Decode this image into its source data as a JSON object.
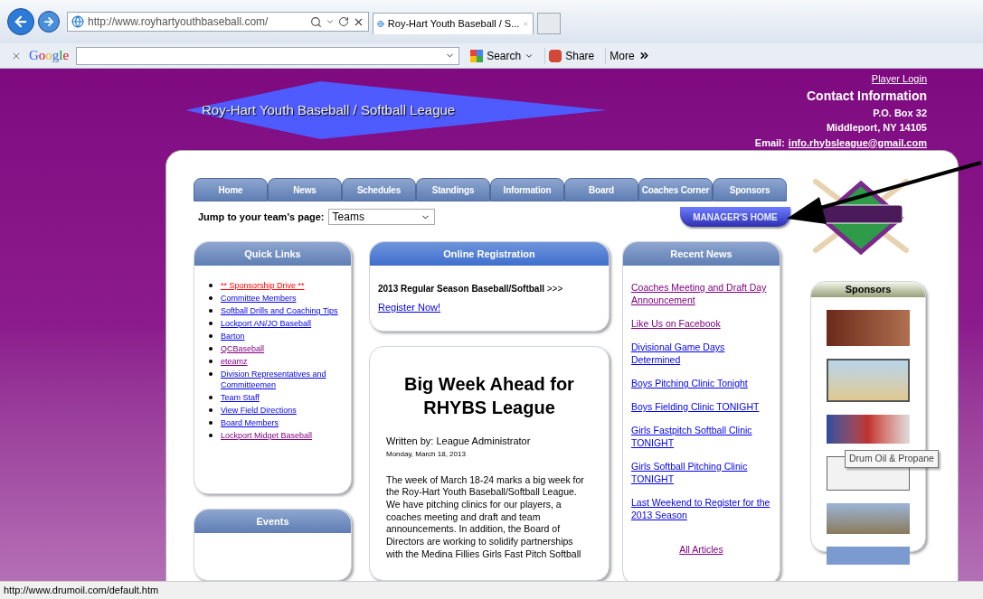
{
  "browser": {
    "url": "http://www.royhartyouthbaseball.com/",
    "tabs": [
      {
        "label": "Roy-Hart Youth Baseball / S...",
        "selected": true
      }
    ],
    "toolbar": {
      "brand": "Google",
      "search": "Search",
      "share": "Share",
      "more": "More"
    }
  },
  "header": {
    "banner_title": "Roy-Hart Youth Baseball / Softball League",
    "player_login": "Player Login",
    "contact_heading": "Contact Information",
    "contact_lines": [
      "P.O. Box 32",
      "Middleport, NY 14105"
    ],
    "email_label": "Email:",
    "email": "info.rhybsleague@gmail.com"
  },
  "nav": [
    {
      "label": "Home"
    },
    {
      "label": "News"
    },
    {
      "label": "Schedules"
    },
    {
      "label": "Standings"
    },
    {
      "label": "Information"
    },
    {
      "label": "Board"
    },
    {
      "label": "Coaches Corner"
    },
    {
      "label": "Sponsors"
    }
  ],
  "jump": {
    "label": "Jump to your team's page:",
    "value": "Teams"
  },
  "manager_button": "MANAGER'S HOME",
  "quick_links": {
    "title": "Quick Links",
    "items": [
      {
        "label": "** Sponsorship Drive **",
        "kind": "highlight"
      },
      {
        "label": "Committee Members",
        "kind": "link",
        "visited": false
      },
      {
        "label": "Softball Drills and Coaching Tips",
        "kind": "link",
        "visited": false
      },
      {
        "label": "Lockport AN/JO Baseball",
        "kind": "link",
        "visited": false
      },
      {
        "label": "Barton",
        "kind": "link",
        "visited": false
      },
      {
        "label": "QCBaseball",
        "kind": "link",
        "visited": true
      },
      {
        "label": "eteamz",
        "kind": "link",
        "visited": true
      },
      {
        "label": "Division Representatives and Committeemen",
        "kind": "link",
        "visited": false
      },
      {
        "label": "Team Staff",
        "kind": "link",
        "visited": false
      },
      {
        "label": "View Field Directions",
        "kind": "link",
        "visited": false
      },
      {
        "label": "Board Members",
        "kind": "link",
        "visited": false
      },
      {
        "label": "Lockport Midget Baseball",
        "kind": "link",
        "visited": true
      }
    ]
  },
  "events": {
    "title": "Events"
  },
  "registration": {
    "title": "Online Registration",
    "text": "**2013 Regular Season Baseball/Softball** >>>",
    "link": "Register Now!"
  },
  "article": {
    "title": "Big Week Ahead for RHYBS League",
    "byline": "Written by: League Administrator",
    "date": "Monday, March 18, 2013",
    "body": "The week of March 18-24 marks a big week for the Roy-Hart Youth Baseball/Softball League. We have pitching clinics for our players, a coaches meeting and draft and team announcements.  In addition, the Board of Directors are working to solidify partnerships with the Medina Fillies Girls Fast Pitch Softball"
  },
  "recent_news": {
    "title": "Recent News",
    "items": [
      {
        "label": "Coaches Meeting and Draft Day Announcement",
        "visited": true
      },
      {
        "label": "Like Us on Facebook",
        "visited": true
      },
      {
        "label": "Divisional Game Days Determined",
        "visited": false
      },
      {
        "label": "Boys Pitching Clinic Tonight",
        "visited": false
      },
      {
        "label": "Boys Fielding Clinic TONIGHT",
        "visited": false
      },
      {
        "label": "Girls Fastpitch Softball Clinic TONIGHT",
        "visited": false
      },
      {
        "label": "Girls Softball Pitching Clinic TONIGHT",
        "visited": false
      },
      {
        "label": "Last Weekend to Register for the 2013 Season",
        "visited": false
      }
    ],
    "all_link": "All Articles"
  },
  "sponsors": {
    "title": "Sponsors",
    "tooltip": "Drum Oil & Propane"
  },
  "status_bar": "http://www.drumoil.com/default.htm"
}
